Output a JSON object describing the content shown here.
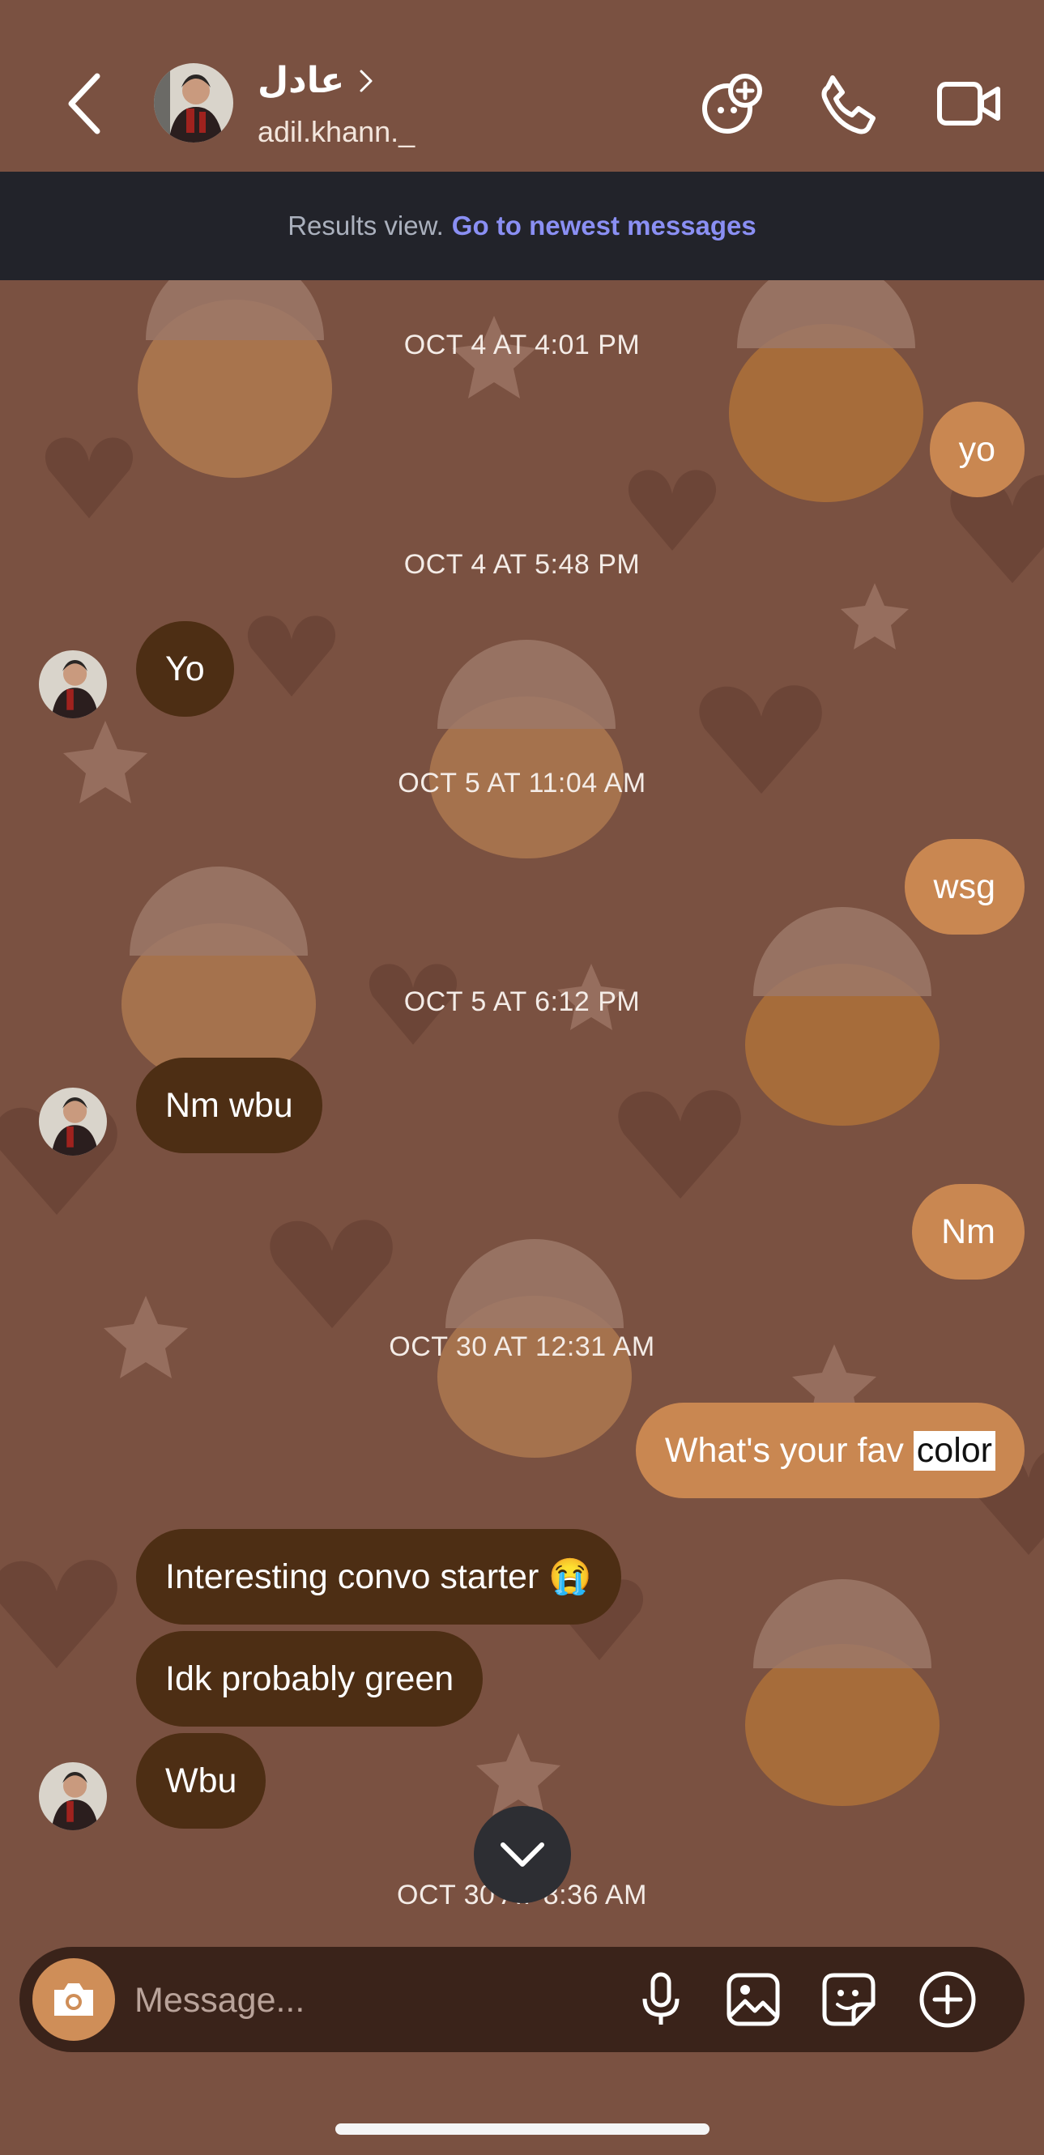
{
  "header": {
    "contact_name": "عادل",
    "handle": "adil.khann._"
  },
  "banner": {
    "text": "Results view.",
    "link": "Go to newest messages"
  },
  "timestamps": [
    "OCT 4 AT 4:01 PM",
    "OCT 4 AT 5:48 PM",
    "OCT 5 AT 11:04 AM",
    "OCT 5 AT 6:12 PM",
    "OCT 30 AT 12:31 AM",
    "OCT 30 AT 8:36 AM"
  ],
  "messages": [
    {
      "from": "me",
      "text": "yo"
    },
    {
      "from": "them",
      "text": "Yo"
    },
    {
      "from": "me",
      "text": "wsg"
    },
    {
      "from": "them",
      "text": "Nm wbu"
    },
    {
      "from": "me",
      "text": "Nm"
    },
    {
      "from": "me",
      "text": "What's your fav ",
      "highlight": "color"
    },
    {
      "from": "them",
      "text": "Interesting convo starter 😭"
    },
    {
      "from": "them",
      "text": "Idk probably green"
    },
    {
      "from": "them",
      "text": "Wbu"
    }
  ],
  "composer": {
    "placeholder": "Message..."
  },
  "icons": {
    "back": "chevron-left-icon",
    "new_chat": "video-chat-icon",
    "call": "phone-icon",
    "video": "video-camera-icon",
    "camera": "camera-icon",
    "mic": "microphone-icon",
    "gallery": "gallery-icon",
    "sticker": "sticker-icon",
    "add": "plus-icon",
    "scroll_down": "chevron-down-icon"
  },
  "colors": {
    "background": "#7a5141",
    "incoming_bubble": "#4d2e14",
    "outgoing_bubble": "#c98751",
    "banner_bg": "#22232a",
    "banner_link": "#8a8ff3"
  }
}
